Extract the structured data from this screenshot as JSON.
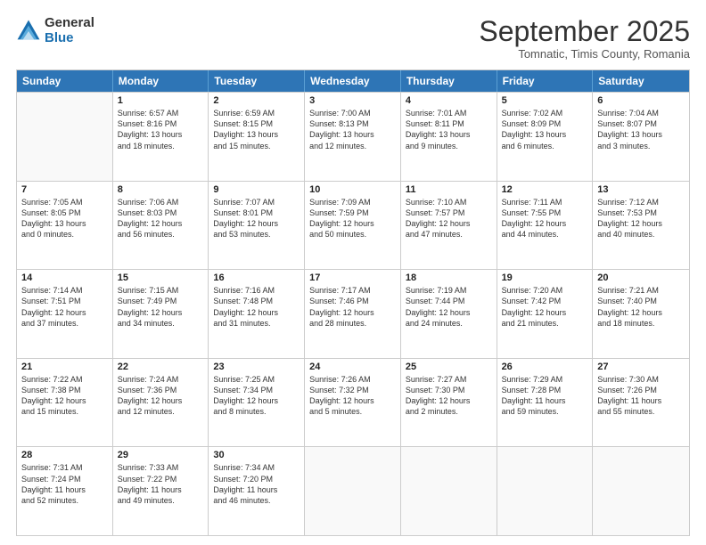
{
  "header": {
    "logo_general": "General",
    "logo_blue": "Blue",
    "month_title": "September 2025",
    "location": "Tomnatic, Timis County, Romania"
  },
  "weekdays": [
    "Sunday",
    "Monday",
    "Tuesday",
    "Wednesday",
    "Thursday",
    "Friday",
    "Saturday"
  ],
  "weeks": [
    [
      {
        "day": "",
        "info": ""
      },
      {
        "day": "1",
        "info": "Sunrise: 6:57 AM\nSunset: 8:16 PM\nDaylight: 13 hours\nand 18 minutes."
      },
      {
        "day": "2",
        "info": "Sunrise: 6:59 AM\nSunset: 8:15 PM\nDaylight: 13 hours\nand 15 minutes."
      },
      {
        "day": "3",
        "info": "Sunrise: 7:00 AM\nSunset: 8:13 PM\nDaylight: 13 hours\nand 12 minutes."
      },
      {
        "day": "4",
        "info": "Sunrise: 7:01 AM\nSunset: 8:11 PM\nDaylight: 13 hours\nand 9 minutes."
      },
      {
        "day": "5",
        "info": "Sunrise: 7:02 AM\nSunset: 8:09 PM\nDaylight: 13 hours\nand 6 minutes."
      },
      {
        "day": "6",
        "info": "Sunrise: 7:04 AM\nSunset: 8:07 PM\nDaylight: 13 hours\nand 3 minutes."
      }
    ],
    [
      {
        "day": "7",
        "info": "Sunrise: 7:05 AM\nSunset: 8:05 PM\nDaylight: 13 hours\nand 0 minutes."
      },
      {
        "day": "8",
        "info": "Sunrise: 7:06 AM\nSunset: 8:03 PM\nDaylight: 12 hours\nand 56 minutes."
      },
      {
        "day": "9",
        "info": "Sunrise: 7:07 AM\nSunset: 8:01 PM\nDaylight: 12 hours\nand 53 minutes."
      },
      {
        "day": "10",
        "info": "Sunrise: 7:09 AM\nSunset: 7:59 PM\nDaylight: 12 hours\nand 50 minutes."
      },
      {
        "day": "11",
        "info": "Sunrise: 7:10 AM\nSunset: 7:57 PM\nDaylight: 12 hours\nand 47 minutes."
      },
      {
        "day": "12",
        "info": "Sunrise: 7:11 AM\nSunset: 7:55 PM\nDaylight: 12 hours\nand 44 minutes."
      },
      {
        "day": "13",
        "info": "Sunrise: 7:12 AM\nSunset: 7:53 PM\nDaylight: 12 hours\nand 40 minutes."
      }
    ],
    [
      {
        "day": "14",
        "info": "Sunrise: 7:14 AM\nSunset: 7:51 PM\nDaylight: 12 hours\nand 37 minutes."
      },
      {
        "day": "15",
        "info": "Sunrise: 7:15 AM\nSunset: 7:49 PM\nDaylight: 12 hours\nand 34 minutes."
      },
      {
        "day": "16",
        "info": "Sunrise: 7:16 AM\nSunset: 7:48 PM\nDaylight: 12 hours\nand 31 minutes."
      },
      {
        "day": "17",
        "info": "Sunrise: 7:17 AM\nSunset: 7:46 PM\nDaylight: 12 hours\nand 28 minutes."
      },
      {
        "day": "18",
        "info": "Sunrise: 7:19 AM\nSunset: 7:44 PM\nDaylight: 12 hours\nand 24 minutes."
      },
      {
        "day": "19",
        "info": "Sunrise: 7:20 AM\nSunset: 7:42 PM\nDaylight: 12 hours\nand 21 minutes."
      },
      {
        "day": "20",
        "info": "Sunrise: 7:21 AM\nSunset: 7:40 PM\nDaylight: 12 hours\nand 18 minutes."
      }
    ],
    [
      {
        "day": "21",
        "info": "Sunrise: 7:22 AM\nSunset: 7:38 PM\nDaylight: 12 hours\nand 15 minutes."
      },
      {
        "day": "22",
        "info": "Sunrise: 7:24 AM\nSunset: 7:36 PM\nDaylight: 12 hours\nand 12 minutes."
      },
      {
        "day": "23",
        "info": "Sunrise: 7:25 AM\nSunset: 7:34 PM\nDaylight: 12 hours\nand 8 minutes."
      },
      {
        "day": "24",
        "info": "Sunrise: 7:26 AM\nSunset: 7:32 PM\nDaylight: 12 hours\nand 5 minutes."
      },
      {
        "day": "25",
        "info": "Sunrise: 7:27 AM\nSunset: 7:30 PM\nDaylight: 12 hours\nand 2 minutes."
      },
      {
        "day": "26",
        "info": "Sunrise: 7:29 AM\nSunset: 7:28 PM\nDaylight: 11 hours\nand 59 minutes."
      },
      {
        "day": "27",
        "info": "Sunrise: 7:30 AM\nSunset: 7:26 PM\nDaylight: 11 hours\nand 55 minutes."
      }
    ],
    [
      {
        "day": "28",
        "info": "Sunrise: 7:31 AM\nSunset: 7:24 PM\nDaylight: 11 hours\nand 52 minutes."
      },
      {
        "day": "29",
        "info": "Sunrise: 7:33 AM\nSunset: 7:22 PM\nDaylight: 11 hours\nand 49 minutes."
      },
      {
        "day": "30",
        "info": "Sunrise: 7:34 AM\nSunset: 7:20 PM\nDaylight: 11 hours\nand 46 minutes."
      },
      {
        "day": "",
        "info": ""
      },
      {
        "day": "",
        "info": ""
      },
      {
        "day": "",
        "info": ""
      },
      {
        "day": "",
        "info": ""
      }
    ]
  ]
}
